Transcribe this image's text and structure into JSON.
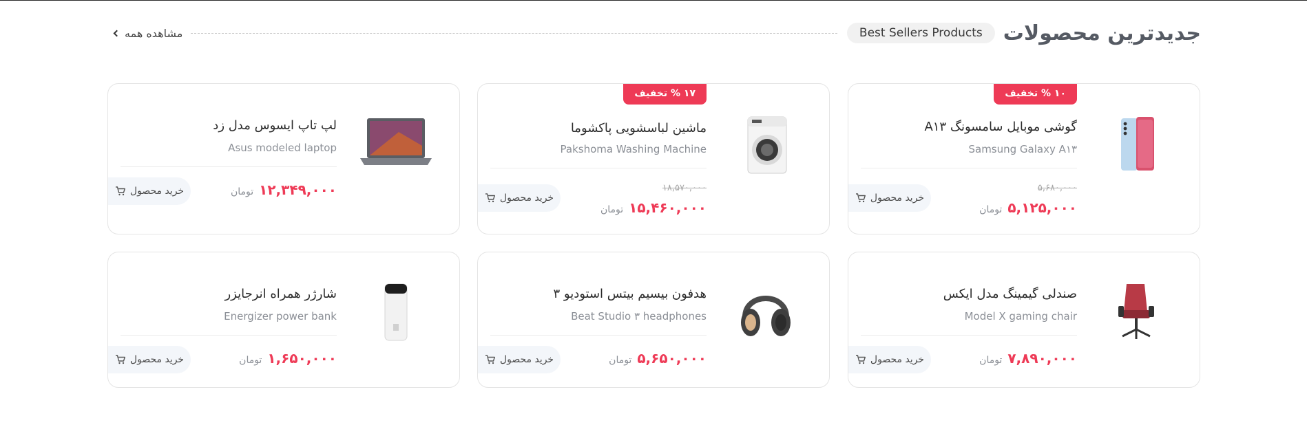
{
  "section": {
    "title": "جدیدترین محصولات",
    "pill": "Best Sellers Products",
    "view_all": "مشاهده همه"
  },
  "currency": "تومان",
  "buy_label": "خرید محصول",
  "products": [
    {
      "name": "گوشی موبایل سامسونگ A۱۳",
      "en": "Samsung Galaxy A۱۳",
      "badge": "۱۰ % تخفیف",
      "old_price": "۵,۶۸۰,۰۰۰",
      "price": "۵,۱۲۵,۰۰۰",
      "icon": "phone-icon"
    },
    {
      "name": "ماشین لباسشویی پاکشوما",
      "en": "Pakshoma Washing Machine",
      "badge": "۱۷ % تخفیف",
      "old_price": "۱۸,۵۷۰,۰۰۰",
      "price": "۱۵,۴۶۰,۰۰۰",
      "icon": "washing-machine-icon"
    },
    {
      "name": "لپ تاپ ایسوس مدل زد",
      "en": "Asus modeled laptop",
      "price": "۱۲,۳۴۹,۰۰۰",
      "icon": "laptop-icon"
    },
    {
      "name": "صندلی گیمینگ مدل ایکس",
      "en": "Model X gaming chair",
      "price": "۷,۸۹۰,۰۰۰",
      "icon": "gaming-chair-icon"
    },
    {
      "name": "هدفون بیسیم بیتس استودیو ۳",
      "en": "Beat Studio ۳ headphones",
      "price": "۵,۶۵۰,۰۰۰",
      "icon": "headphones-icon"
    },
    {
      "name": "شارژر همراه انرجایزر",
      "en": "Energizer power bank",
      "price": "۱,۶۵۰,۰۰۰",
      "icon": "power-bank-icon"
    }
  ],
  "colors": {
    "accent": "#ee3a56",
    "muted": "#8b8f96",
    "buy_bg": "#f3f6fa"
  }
}
